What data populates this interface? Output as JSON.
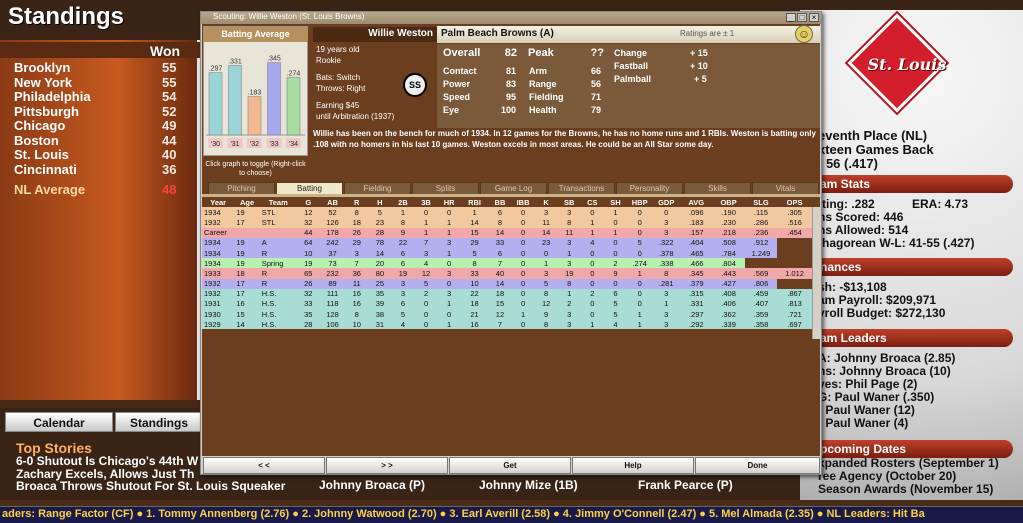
{
  "standings": {
    "title": "Standings",
    "won_label": "Won",
    "teams": [
      {
        "name": "Brooklyn",
        "won": "55"
      },
      {
        "name": "New York",
        "won": "55"
      },
      {
        "name": "Philadelphia",
        "won": "54"
      },
      {
        "name": "Pittsburgh",
        "won": "52"
      },
      {
        "name": "Chicago",
        "won": "49"
      },
      {
        "name": "Boston",
        "won": "44"
      },
      {
        "name": "St. Louis",
        "won": "40"
      },
      {
        "name": "Cincinnati",
        "won": "36"
      }
    ],
    "nl_average_label": "NL Average",
    "nl_average_value": "48"
  },
  "right_panel": {
    "logo_text": "St. Louis",
    "place": "eventh Place (NL)",
    "games_back": "xteen Games Back",
    "record": "- 56 (.417)",
    "team_stats_head": "am Stats",
    "batting": "tting: .282",
    "era": "ERA: 4.73",
    "runs_scored": "ns Scored: 446",
    "runs_allowed": "ns Allowed: 514",
    "pythag": "thagorean W-L: 41-55 (.427)",
    "finances_head": "nances",
    "cash": "sh: -$13,108",
    "payroll": "am Payroll: $209,971",
    "budget": "yroll Budget: $272,130",
    "leaders_head": "am Leaders",
    "leader1": "A: Johnny Broaca (2.85)",
    "leader2": "ns: Johnny Broaca (10)",
    "leader3": "ves: Phil Page (2)",
    "leader4": "G: Paul Waner (.350)",
    "leader5": ": Paul Waner (12)",
    "leader6": ": Paul Waner (4)",
    "dates_head": "pcoming Dates",
    "date1": "xpanded Rosters (September 1)",
    "date2": "ree Agency (October 20)",
    "date3": "Season Awards (November 15)"
  },
  "bottom": {
    "tab_calendar": "Calendar",
    "tab_standings": "Standings",
    "top_stories_head": "Top Stories",
    "story1": "6-0 Shutout Is Chicago's 44th W",
    "story2": "Zachary Excels, Allows Just Th",
    "story3": "Broaca Throws Shutout For St. Louis Squeaker",
    "player1": "Johnny Broaca (P)",
    "player2": "Johnny Mize (1B)",
    "player3": "Frank Pearce (P)",
    "ticker": "aders: Range Factor (CF)  ●  1. Tommy Annenberg (2.76)  ●  2. Johnny Watwood (2.70)  ●  3. Earl Averill (2.58)  ●  4. Jimmy O'Connell (2.47)  ●  5. Mel Almada (2.35)  ●  NL Leaders: Hit Ba"
  },
  "dialog": {
    "title": "Scouting: Willie Weston (St. Louis Browns)",
    "player_name": "Willie Weston",
    "team": "Palm Beach Browns (A)",
    "ratings_note": "Ratings are ± 1",
    "chart_title": "Batting Average",
    "chart_hint": "Click graph to toggle (Right-click to choose)",
    "bio": {
      "age": "19 years old",
      "status": "Rookie",
      "bats": "Bats: Switch",
      "throws": "Throws: Right",
      "earning": "Earning $45",
      "arb": "until Arbitration (1937)"
    },
    "position": "SS",
    "ratings": {
      "overall_label": "Overall",
      "overall": "82",
      "peak_label": "Peak",
      "peak": "??",
      "contact_label": "Contact",
      "contact": "81",
      "power_label": "Power",
      "power": "83",
      "speed_label": "Speed",
      "speed": "95",
      "eye_label": "Eye",
      "eye": "100",
      "arm_label": "Arm",
      "arm": "66",
      "range_label": "Range",
      "range": "56",
      "fielding_label": "Fielding",
      "fielding": "71",
      "health_label": "Health",
      "health": "79",
      "change_label": "Change",
      "change": "+ 15",
      "fastball_label": "Fastball",
      "fastball": "+ 10",
      "palmball_label": "Palmball",
      "palmball": "+ 5"
    },
    "summary": "Willie has been on the bench for much of 1934. In 12 games for the Browns, he has no home runs and 1 RBIs. Weston is batting only .108 with no homers in his last 10 games. Weston excels in most areas. He could be an All Star some day.",
    "tabs": [
      "Pitching",
      "Batting",
      "Fielding",
      "Splits",
      "Game Log",
      "Transactions",
      "Personality",
      "Skills",
      "Vitals"
    ],
    "columns": [
      "Year",
      "Age",
      "Team",
      "G",
      "AB",
      "R",
      "H",
      "2B",
      "3B",
      "HR",
      "RBI",
      "BB",
      "IBB",
      "K",
      "SB",
      "CS",
      "SH",
      "HBP",
      "GDP",
      "AVG",
      "OBP",
      "SLG",
      "OPS"
    ],
    "rows": [
      [
        "1934",
        "19",
        "STL",
        "12",
        "52",
        "8",
        "5",
        "1",
        "0",
        "0",
        "1",
        "6",
        "0",
        "3",
        "3",
        "0",
        "1",
        "0",
        "0",
        ".096",
        ".190",
        ".115",
        ".305"
      ],
      [
        "1932",
        "17",
        "STL",
        "32",
        "126",
        "18",
        "23",
        "8",
        "1",
        "1",
        "14",
        "8",
        "0",
        "11",
        "8",
        "1",
        "0",
        "0",
        "3",
        ".183",
        ".230",
        ".286",
        ".516"
      ],
      [
        "Career",
        "",
        "",
        "44",
        "178",
        "26",
        "28",
        "9",
        "1",
        "1",
        "15",
        "14",
        "0",
        "14",
        "11",
        "1",
        "1",
        "0",
        "3",
        ".157",
        ".218",
        ".236",
        ".454"
      ],
      [
        "1934",
        "19",
        "A",
        "64",
        "242",
        "29",
        "78",
        "22",
        "7",
        "3",
        "29",
        "33",
        "0",
        "23",
        "3",
        "4",
        "0",
        "5",
        ".322",
        ".404",
        ".508",
        ".912"
      ],
      [
        "1934",
        "19",
        "R",
        "10",
        "37",
        "3",
        "14",
        "6",
        "3",
        "1",
        "5",
        "6",
        "0",
        "0",
        "1",
        "0",
        "0",
        "0",
        ".378",
        ".465",
        ".784",
        "1.249"
      ],
      [
        "1934",
        "19",
        "Spring",
        "19",
        "73",
        "7",
        "20",
        "6",
        "4",
        "0",
        "8",
        "7",
        "0",
        "1",
        "3",
        "0",
        "2",
        ".274",
        ".338",
        ".466",
        ".804"
      ],
      [
        "1933",
        "18",
        "R",
        "65",
        "232",
        "36",
        "80",
        "19",
        "12",
        "3",
        "33",
        "40",
        "0",
        "3",
        "19",
        "0",
        "9",
        "1",
        "8",
        ".345",
        ".443",
        ".569",
        "1.012"
      ],
      [
        "1932",
        "17",
        "R",
        "26",
        "89",
        "11",
        "25",
        "3",
        "5",
        "0",
        "10",
        "14",
        "0",
        "5",
        "8",
        "0",
        "0",
        "0",
        ".281",
        ".379",
        ".427",
        ".806"
      ],
      [
        "1932",
        "17",
        "H.S.",
        "32",
        "111",
        "16",
        "35",
        "3",
        "2",
        "3",
        "22",
        "18",
        "0",
        "8",
        "1",
        "2",
        "6",
        "0",
        "3",
        ".315",
        ".408",
        ".459",
        ".867"
      ],
      [
        "1931",
        "16",
        "H.S.",
        "33",
        "118",
        "16",
        "39",
        "6",
        "0",
        "1",
        "18",
        "15",
        "0",
        "12",
        "2",
        "0",
        "5",
        "0",
        "1",
        ".331",
        ".406",
        ".407",
        ".813"
      ],
      [
        "1930",
        "15",
        "H.S.",
        "35",
        "128",
        "8",
        "38",
        "5",
        "0",
        "0",
        "21",
        "12",
        "1",
        "9",
        "3",
        "0",
        "5",
        "1",
        "3",
        ".297",
        ".362",
        ".359",
        ".721"
      ],
      [
        "1929",
        "14",
        "H.S.",
        "28",
        "106",
        "10",
        "31",
        "4",
        "0",
        "1",
        "16",
        "7",
        "0",
        "8",
        "3",
        "1",
        "4",
        "1",
        "3",
        ".292",
        ".339",
        ".358",
        ".697"
      ]
    ],
    "row_colors": [
      "#f2c8a0",
      "#f2c8a0",
      "#f0a8a8",
      "#b4b0f0",
      "#b4b0f0",
      "#b8f0b0",
      "#f0a8a8",
      "#b4b0f0",
      "#a8dcd4",
      "#a8dcd4",
      "#a8dcd4",
      "#a8dcd4"
    ],
    "buttons": {
      "prev": "< <",
      "next": "> >",
      "get": "Get",
      "help": "Help",
      "done": "Done"
    }
  },
  "chart_data": {
    "type": "bar",
    "title": "Batting Average",
    "categories": [
      "'30",
      "'31",
      "'32",
      "'33",
      "'34"
    ],
    "values": [
      0.297,
      0.331,
      0.183,
      0.345,
      0.274
    ],
    "labels": [
      ".297",
      ".331",
      ".183",
      ".345",
      ".274"
    ],
    "colors": [
      "#9ad4d8",
      "#9ad4d8",
      "#f4b890",
      "#a8a8f0",
      "#a8dca0"
    ]
  }
}
